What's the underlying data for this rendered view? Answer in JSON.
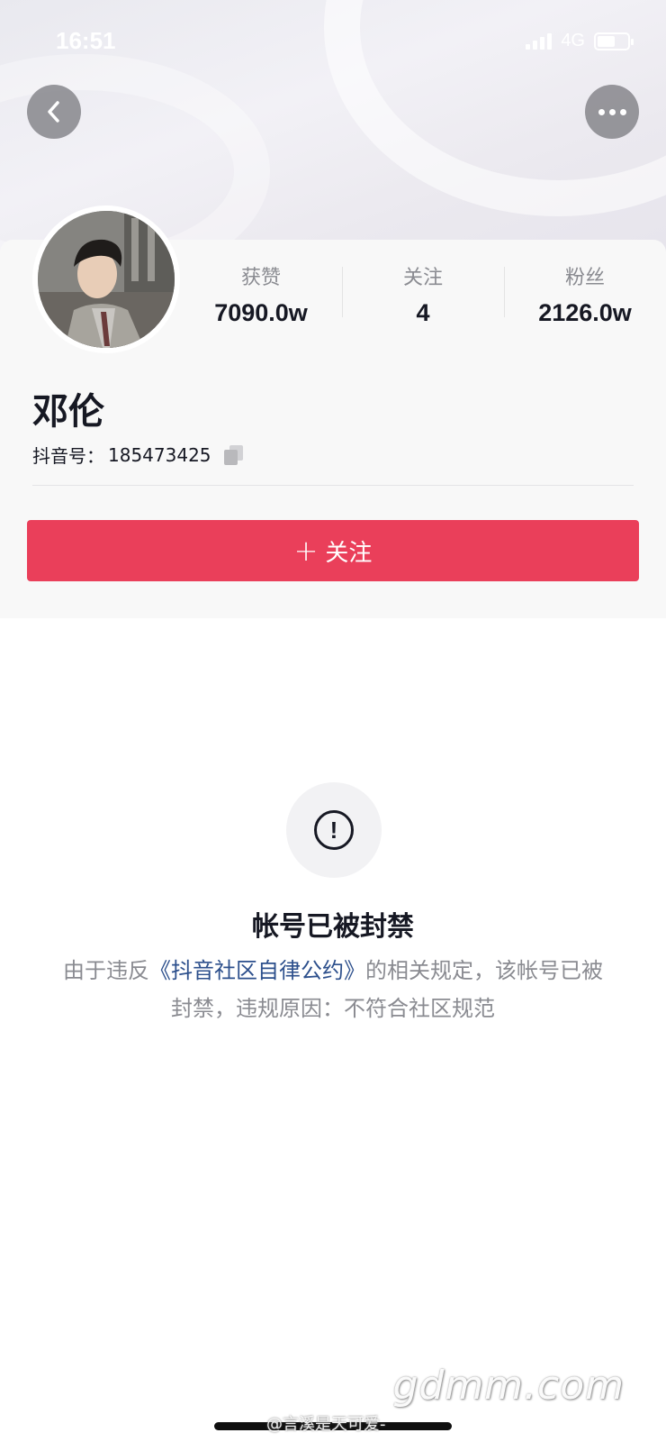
{
  "status_bar": {
    "time": "16:51",
    "network": "4G"
  },
  "profile": {
    "name": "邓伦",
    "douyin_id_label": "抖音号：",
    "douyin_id": "185473425",
    "stats": [
      {
        "label": "获赞",
        "value": "7090.0w"
      },
      {
        "label": "关注",
        "value": "4"
      },
      {
        "label": "粉丝",
        "value": "2126.0w"
      }
    ],
    "follow_button": "关注"
  },
  "banned": {
    "title": "帐号已被封禁",
    "desc_prefix": "由于违反",
    "desc_link": "《抖音社区自律公约》",
    "desc_suffix": "的相关规定，该帐号已被封禁，违规原因：不符合社区规范"
  },
  "watermark": {
    "site": "gdmm.com",
    "weibo": "@言溪是天可爱-"
  },
  "icons": {
    "back": "chevron-left-icon",
    "more": "more-dots-icon",
    "copy": "copy-icon",
    "warning": "exclamation-circle-icon"
  }
}
